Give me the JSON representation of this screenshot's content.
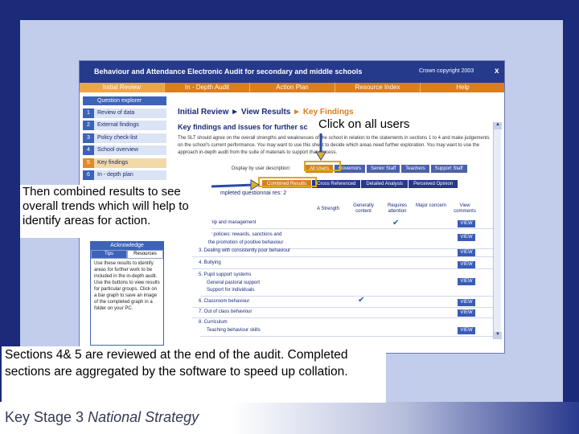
{
  "app": {
    "title": "Behaviour and Attendance Electronic Audit for secondary and middle schools",
    "copyright": "Crown copyright 2003",
    "close": "x",
    "nav": [
      "Initial Review",
      "In - Depth Audit",
      "Action Plan",
      "Resource Index",
      "Help"
    ]
  },
  "sidebar": {
    "heading": "Question explorer",
    "items": [
      {
        "num": "1",
        "label": "Review of data"
      },
      {
        "num": "2",
        "label": "External findings"
      },
      {
        "num": "3",
        "label": "Policy check-list"
      },
      {
        "num": "4",
        "label": "School overview"
      },
      {
        "num": "5",
        "label": "Key findings"
      },
      {
        "num": "6",
        "label": "In - depth plan"
      }
    ]
  },
  "content": {
    "breadcrumb_1": "Initial Review",
    "breadcrumb_2": "View Results",
    "breadcrumb_3": "Key Findings",
    "sep": "►",
    "kf_title": "Key findings and issues for further sc",
    "description": "The SLT should agree on the overall strengths and weaknesses of the school in relation to the statements in sections 1 to 4 and make judgements on the school's current performance. You may want to use this sheet to decide which areas need further exploration. You may want to use the approach in-depth audit from the suite of materials to support that process.",
    "display_label": "Display by user description:",
    "user_buttons": [
      "All Users",
      "Governors",
      "Senior Staff",
      "Teachers",
      "Support Staff"
    ],
    "analysis_tabs": [
      "Combined Results",
      "Cross Referenced",
      "Detailed Analysis",
      "Perceived Opinion"
    ],
    "completed": "mpleted questionnai res:  2",
    "columns": [
      "A Strength",
      "Generally content",
      "Requires attention",
      "Major concern",
      "View comments"
    ],
    "rows": [
      "ship and management",
      "ty policies: rewards, sanctions and",
      "the promotion of positive behaviour",
      "3. Dealing with consistently poor behaviour",
      "4. Bullying",
      "5. Pupil support systems",
      "General pastoral support",
      "Support for individuals",
      "6. Classroom behaviour",
      "7. Out of class behaviour",
      "8. Curriculum",
      "Teaching behaviour skills"
    ],
    "view_label": "VIEW"
  },
  "tips": {
    "title": "Acknowledge",
    "tabs": [
      "Tips",
      "Resources"
    ],
    "text": "Use these results to identify areas for further work to be included in the in-depth audit. Use the buttons to view results for particular groups. Click on a bar graph to save an image of the completed graph in a folder on your PC."
  },
  "callouts": {
    "users": "Click on all users",
    "combined": "Then combined results to see overall trends which will help to identify areas for action.",
    "sections": "Sections 4& 5 are reviewed at the end of the audit. Completed sections are aggregated by the software to speed up collation."
  },
  "footer": {
    "brand": "Key Stage 3",
    "tag": "National Strategy"
  },
  "colors": {
    "navy": "#263a8c",
    "orange": "#dd7d1e",
    "slide_bg": "#c2cdeb",
    "frame": "#1c2a7a"
  }
}
